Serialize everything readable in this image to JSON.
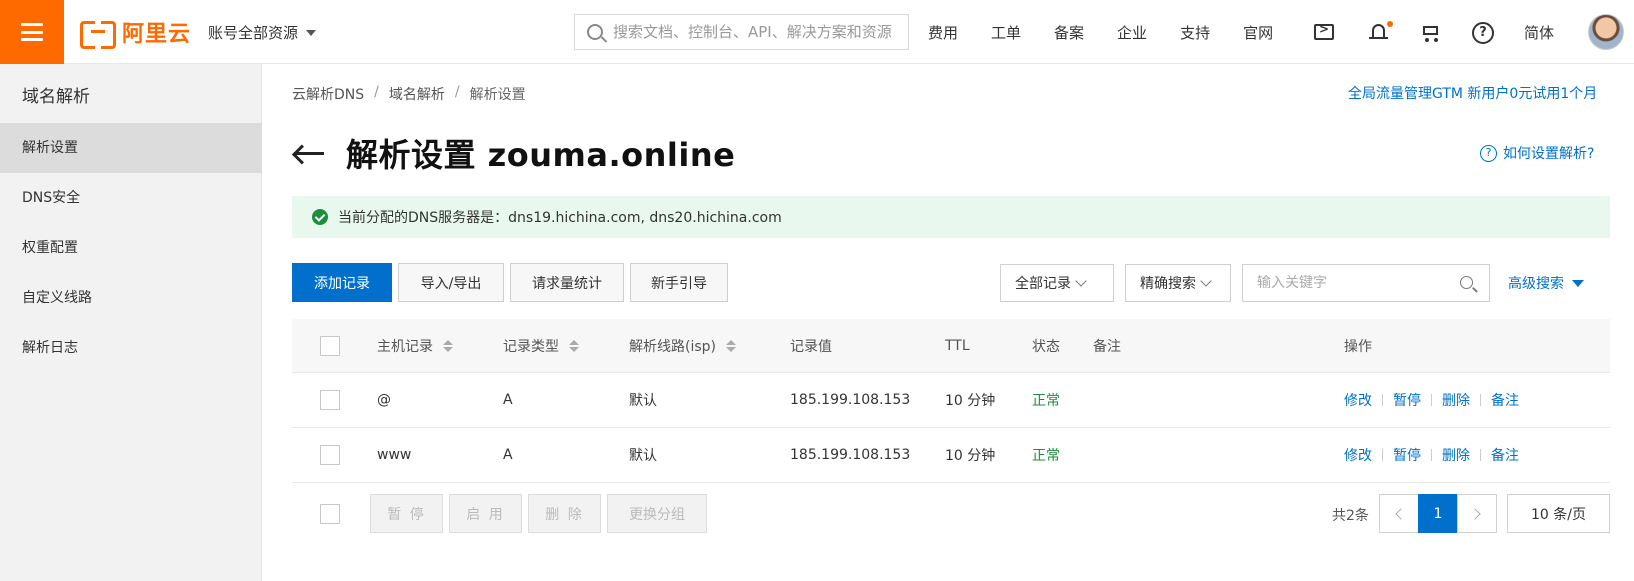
{
  "topbar": {
    "logo_text": "阿里云",
    "account_label": "账号全部资源",
    "search_placeholder": "搜索文档、控制台、API、解决方案和资源",
    "nav_links": [
      "费用",
      "工单",
      "备案",
      "企业",
      "支持",
      "官网"
    ],
    "lang": "简体",
    "icons": [
      "menu-icon",
      "terminal-icon",
      "bell-icon",
      "cart-icon",
      "help-icon"
    ]
  },
  "sidebar": {
    "title": "域名解析",
    "items": [
      {
        "label": "解析设置",
        "active": true
      },
      {
        "label": "DNS安全"
      },
      {
        "label": "权重配置"
      },
      {
        "label": "自定义线路"
      },
      {
        "label": "解析日志"
      }
    ]
  },
  "breadcrumb": [
    "云解析DNS",
    "域名解析",
    "解析设置"
  ],
  "breadcrumb_sep": "/",
  "promo": "全局流量管理GTM 新用户0元试用1个月",
  "page_title": "解析设置 zouma.online",
  "howto": "如何设置解析?",
  "notice": "当前分配的DNS服务器是：dns19.hichina.com, dns20.hichina.com",
  "toolbar": {
    "add_record": "添加记录",
    "import_export": "导入/导出",
    "request_stats": "请求量统计",
    "guide": "新手引导",
    "filter_all": "全部记录",
    "search_mode": "精确搜索",
    "keyword_placeholder": "输入关键字",
    "advanced_search": "高级搜索"
  },
  "table": {
    "headers": {
      "host": "主机记录",
      "type": "记录类型",
      "line": "解析线路(isp)",
      "value": "记录值",
      "ttl": "TTL",
      "status": "状态",
      "remark": "备注",
      "actions": "操作"
    },
    "rows": [
      {
        "host": "@",
        "type": "A",
        "line": "默认",
        "value": "185.199.108.153",
        "ttl": "10 分钟",
        "status": "正常",
        "remark": ""
      },
      {
        "host": "www",
        "type": "A",
        "line": "默认",
        "value": "185.199.108.153",
        "ttl": "10 分钟",
        "status": "正常",
        "remark": ""
      }
    ],
    "row_actions": [
      "修改",
      "暂停",
      "删除",
      "备注"
    ]
  },
  "bulk_actions": [
    "暂 停",
    "启 用",
    "删 除",
    "更换分组"
  ],
  "pagination": {
    "total": "共2条",
    "current_page": "1",
    "page_size": "10 条/页"
  },
  "colors": {
    "brand": "#ff6a00",
    "primary": "#0070cc",
    "success": "#1e8e3e",
    "notice_bg": "#e8f8ee"
  }
}
